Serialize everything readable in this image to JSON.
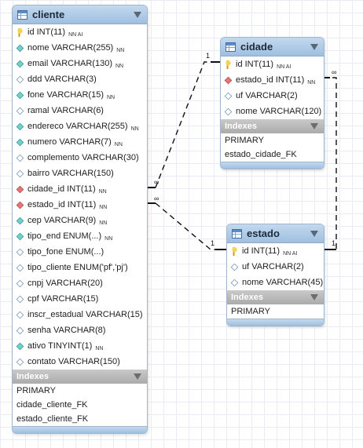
{
  "tables": {
    "cliente": {
      "name": "cliente",
      "columns": [
        {
          "icon": "primary-key-icon",
          "name": "id INT(11)",
          "flags": "NN AI"
        },
        {
          "icon": "column-icon",
          "name": "nome VARCHAR(255)",
          "flags": "NN"
        },
        {
          "icon": "column-icon",
          "name": "email VARCHAR(130)",
          "flags": "NN"
        },
        {
          "icon": "nullable-column-icon",
          "name": "ddd VARCHAR(3)",
          "flags": ""
        },
        {
          "icon": "column-icon",
          "name": "fone VARCHAR(15)",
          "flags": "NN"
        },
        {
          "icon": "nullable-column-icon",
          "name": "ramal VARCHAR(6)",
          "flags": ""
        },
        {
          "icon": "column-icon",
          "name": "endereco VARCHAR(255)",
          "flags": "NN"
        },
        {
          "icon": "column-icon",
          "name": "numero VARCHAR(7)",
          "flags": "NN"
        },
        {
          "icon": "nullable-column-icon",
          "name": "complemento VARCHAR(30)",
          "flags": ""
        },
        {
          "icon": "nullable-column-icon",
          "name": "bairro VARCHAR(150)",
          "flags": ""
        },
        {
          "icon": "foreign-key-icon",
          "name": "cidade_id INT(11)",
          "flags": "NN"
        },
        {
          "icon": "foreign-key-icon",
          "name": "estado_id INT(11)",
          "flags": "NN"
        },
        {
          "icon": "column-icon",
          "name": "cep VARCHAR(9)",
          "flags": "NN"
        },
        {
          "icon": "column-icon",
          "name": "tipo_end ENUM(...)",
          "flags": "NN"
        },
        {
          "icon": "nullable-column-icon",
          "name": "tipo_fone ENUM(...)",
          "flags": ""
        },
        {
          "icon": "nullable-column-icon",
          "name": "tipo_cliente ENUM('pf','pj')",
          "flags": ""
        },
        {
          "icon": "nullable-column-icon",
          "name": "cnpj VARCHAR(20)",
          "flags": ""
        },
        {
          "icon": "nullable-column-icon",
          "name": "cpf VARCHAR(15)",
          "flags": ""
        },
        {
          "icon": "nullable-column-icon",
          "name": "inscr_estadual VARCHAR(15)",
          "flags": ""
        },
        {
          "icon": "nullable-column-icon",
          "name": "senha VARCHAR(8)",
          "flags": ""
        },
        {
          "icon": "column-icon",
          "name": "ativo TINYINT(1)",
          "flags": "NN"
        },
        {
          "icon": "nullable-column-icon",
          "name": "contato VARCHAR(150)",
          "flags": ""
        }
      ],
      "indexes_label": "Indexes",
      "indexes": [
        "PRIMARY",
        "cidade_cliente_FK",
        "estado_cliente_FK"
      ]
    },
    "cidade": {
      "name": "cidade",
      "columns": [
        {
          "icon": "primary-key-icon",
          "name": "id INT(11)",
          "flags": "NN AI"
        },
        {
          "icon": "foreign-key-icon",
          "name": "estado_id INT(11)",
          "flags": "NN"
        },
        {
          "icon": "nullable-column-icon",
          "name": "uf VARCHAR(2)",
          "flags": ""
        },
        {
          "icon": "nullable-column-icon",
          "name": "nome VARCHAR(120)",
          "flags": ""
        }
      ],
      "indexes_label": "Indexes",
      "indexes": [
        "PRIMARY",
        "estado_cidade_FK"
      ]
    },
    "estado": {
      "name": "estado",
      "columns": [
        {
          "icon": "primary-key-icon",
          "name": "id INT(11)",
          "flags": "NN AI"
        },
        {
          "icon": "nullable-column-icon",
          "name": "uf VARCHAR(2)",
          "flags": ""
        },
        {
          "icon": "nullable-column-icon",
          "name": "nome VARCHAR(45)",
          "flags": ""
        }
      ],
      "indexes_label": "Indexes",
      "indexes": [
        "PRIMARY"
      ]
    }
  },
  "relationships": [
    {
      "from": "cliente",
      "to": "cidade",
      "from_card": "∞",
      "to_card": "1"
    },
    {
      "from": "cliente",
      "to": "estado",
      "from_card": "∞",
      "to_card": "1"
    },
    {
      "from": "cidade",
      "to": "estado",
      "from_card": "∞",
      "to_card": "1"
    }
  ],
  "colors": {
    "header": "#9fbfe0",
    "indexes_header": "#ababab",
    "line": "#111111"
  }
}
